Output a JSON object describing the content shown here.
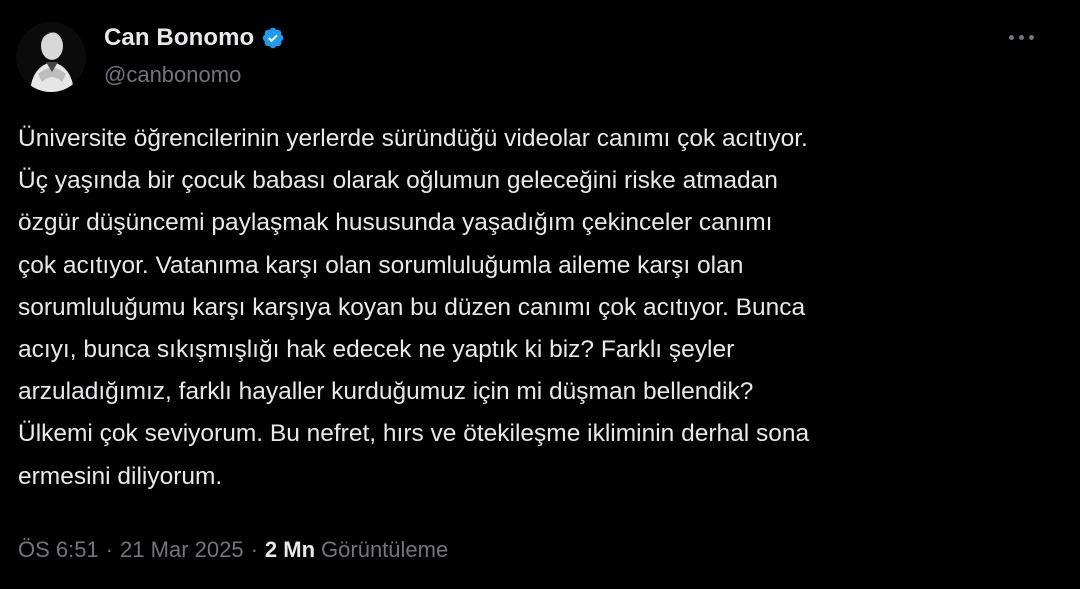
{
  "author": {
    "display_name": "Can Bonomo",
    "handle": "@canbonomo",
    "verified_icon": "verified-badge-icon",
    "avatar_icon": "avatar-portrait"
  },
  "more_icon": "more-horizontal-icon",
  "tweet": {
    "lines": [
      "Üniversite öğrencilerinin yerlerde süründüğü videolar canımı çok acıtıyor.",
      "Üç yaşında bir çocuk babası olarak oğlumun geleceğini riske atmadan",
      "özgür düşüncemi paylaşmak hususunda yaşadığım çekinceler canımı",
      "çok acıtıyor. Vatanıma karşı olan sorumluluğumla aileme karşı olan",
      "sorumluluğumu karşı karşıya koyan bu düzen canımı çok acıtıyor. Bunca",
      "acıyı, bunca sıkışmışlığı hak edecek ne yaptık ki biz? Farklı şeyler",
      "arzuladığımız, farklı hayaller kurduğumuz için mi düşman bellendik?",
      "Ülkemi çok seviyorum. Bu nefret, hırs ve ötekileşme ikliminin derhal sona",
      "ermesini diliyorum."
    ]
  },
  "meta": {
    "time": "ÖS 6:51",
    "separator": "·",
    "date": "21 Mar 2025",
    "views_count": "2 Mn",
    "views_label": "Görüntüleme"
  },
  "colors": {
    "background": "#000000",
    "text": "#e7e9ea",
    "secondary": "#71767b",
    "verified": "#1d9bf0"
  }
}
